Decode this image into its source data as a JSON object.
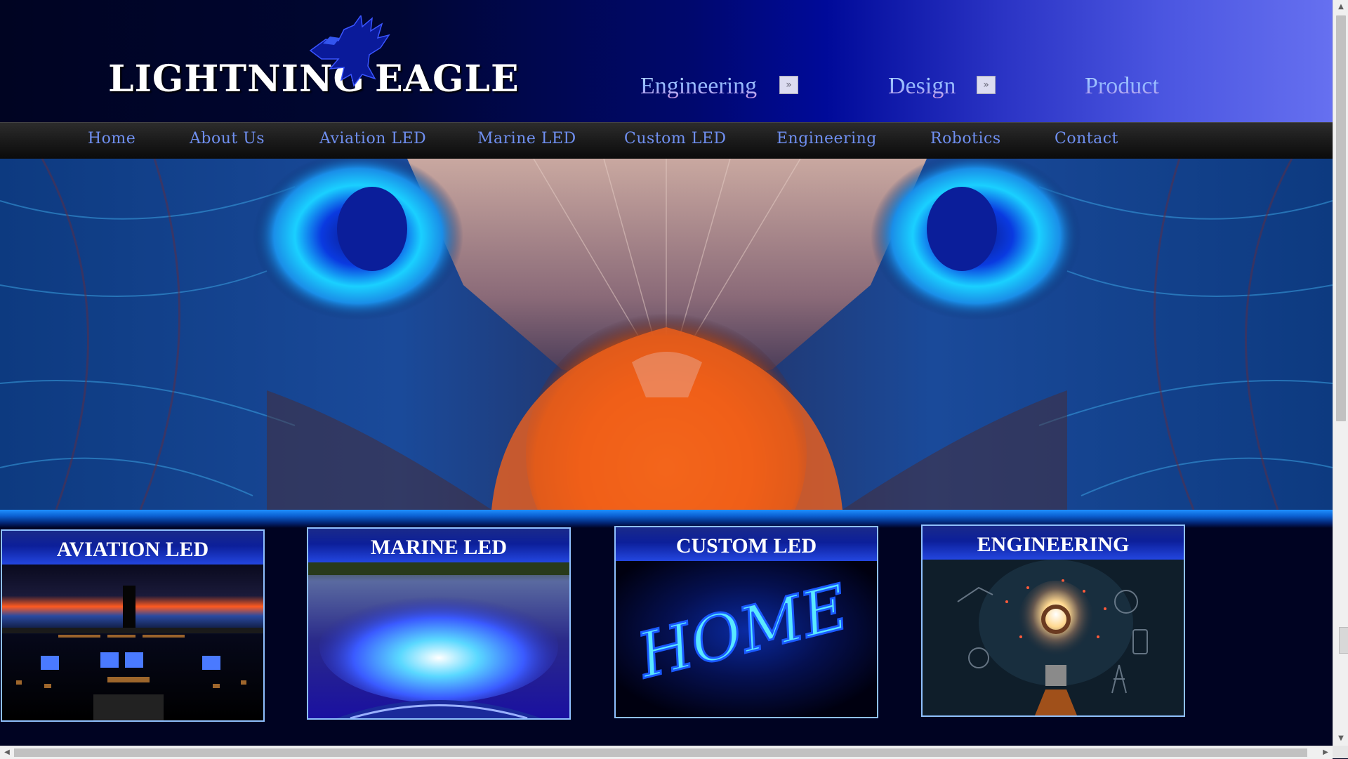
{
  "logo": {
    "word_1": "LIGHTNING",
    "word_2": "EAGLE",
    "icon": "eagle-icon"
  },
  "taglines": [
    {
      "label": "Engineering",
      "has_arrow": true
    },
    {
      "label": "Design",
      "has_arrow": true
    },
    {
      "label": "Product",
      "has_arrow": false
    }
  ],
  "tag_arrow_glyph": "»",
  "nav": {
    "items": [
      {
        "label": "Home"
      },
      {
        "label": "About Us"
      },
      {
        "label": "Aviation LED"
      },
      {
        "label": "Marine LED"
      },
      {
        "label": "Custom LED"
      },
      {
        "label": "Engineering"
      },
      {
        "label": "Robotics"
      },
      {
        "label": "Contact"
      }
    ]
  },
  "cards": [
    {
      "title": "AVIATION LED",
      "image": "cockpit-image"
    },
    {
      "title": "MARINE LED",
      "image": "boat-wake-image"
    },
    {
      "title": "CUSTOM LED",
      "image": "neon-sign-image"
    },
    {
      "title": "ENGINEERING",
      "image": "lightbulb-brain-image"
    }
  ],
  "neon_sign_text": "HOME",
  "colors": {
    "nav_text": "#6f8ff0",
    "card_border": "#8fc0ff",
    "eye_glow": "#1ad0ff",
    "beak": "#ff6a1a"
  }
}
